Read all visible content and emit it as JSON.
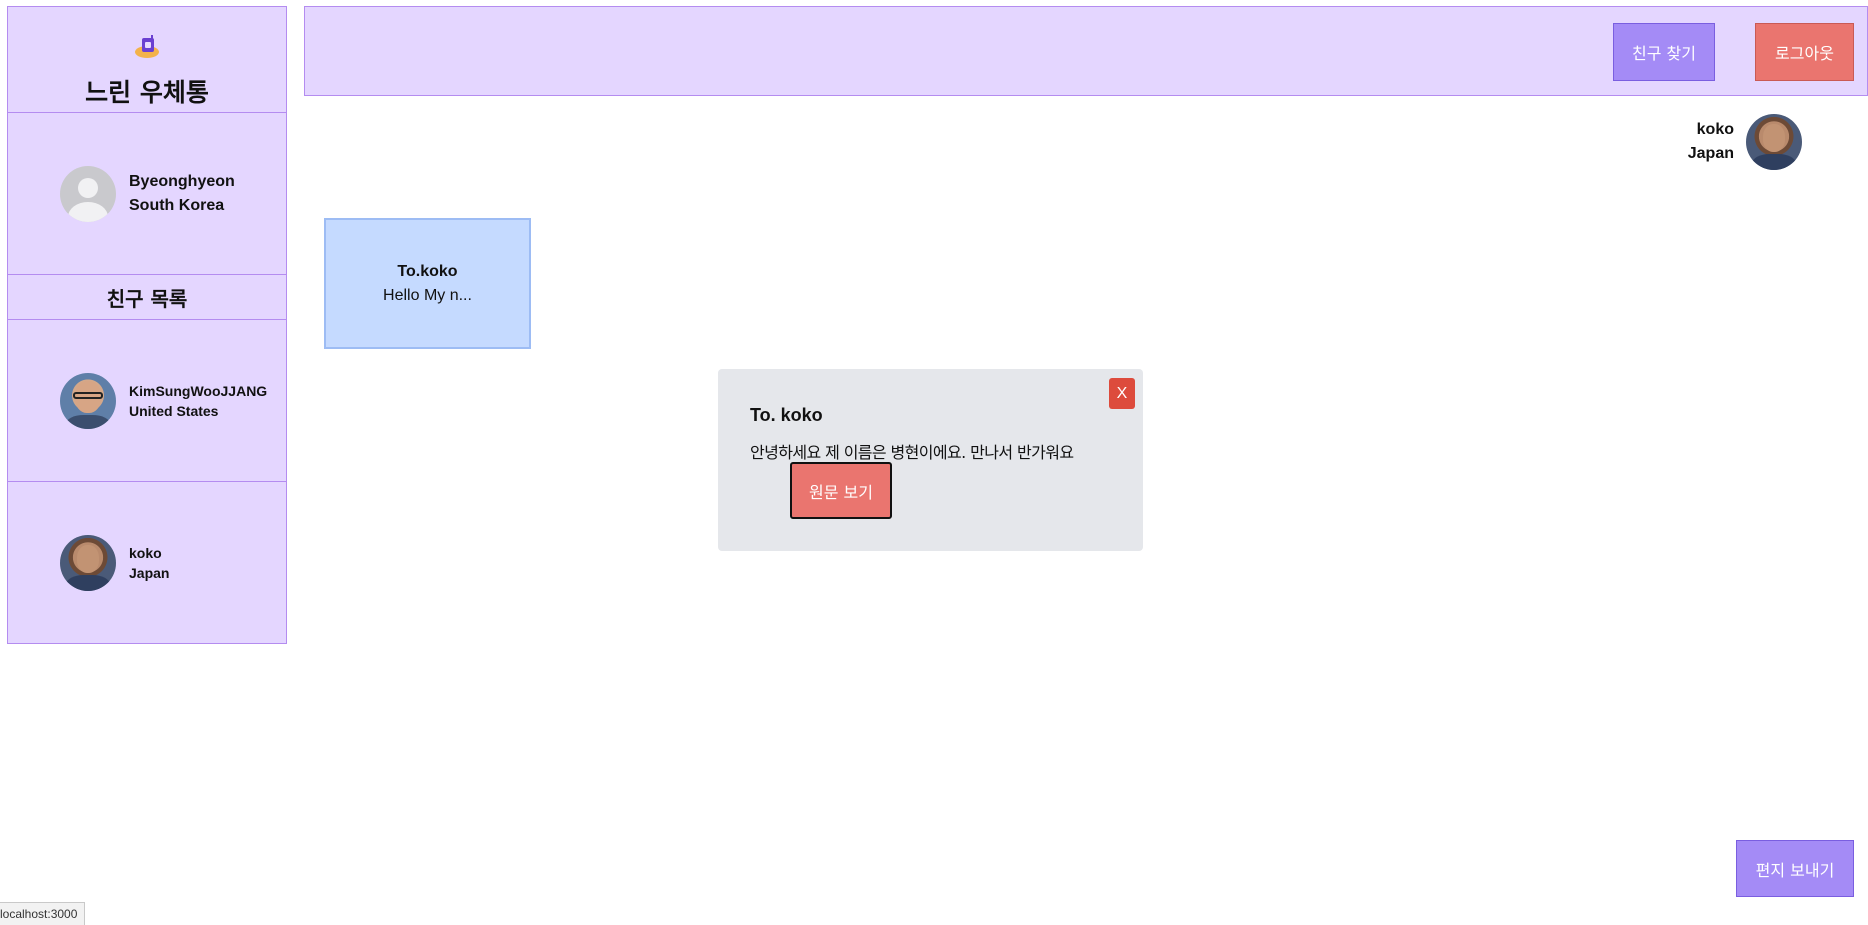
{
  "sidebar": {
    "app_title": "느린 우체통",
    "logo_icon": "mailbox-logo-icon",
    "profile": {
      "name": "Byeonghyeon",
      "country": "South Korea",
      "avatar": "default-avatar-icon"
    },
    "friends_header": "친구 목록",
    "friends": [
      {
        "name": "KimSungWooJJANG",
        "country": "United States"
      },
      {
        "name": "koko",
        "country": "Japan"
      }
    ]
  },
  "header": {
    "find_friends_label": "친구 찾기",
    "logout_label": "로그아웃"
  },
  "current_friend": {
    "name": "koko",
    "country": "Japan"
  },
  "letters": [
    {
      "to": "To.koko",
      "preview": "Hello My n..."
    }
  ],
  "modal": {
    "close_label": "X",
    "title": "To. koko",
    "body": "안녕하세요 제 이름은 병현이에요. 만나서 반가워요",
    "original_button": "원문 보기"
  },
  "send_letter_label": "편지 보내기",
  "status_url": "localhost:3000",
  "colors": {
    "panel": "#e4d6ff",
    "panel_border": "#b48cf0",
    "primary_button": "#a48bf6",
    "danger_button": "#ea756f",
    "letter_card": "#c5daff",
    "modal_bg": "#e5e7eb",
    "close_button": "#dd4b3c"
  }
}
